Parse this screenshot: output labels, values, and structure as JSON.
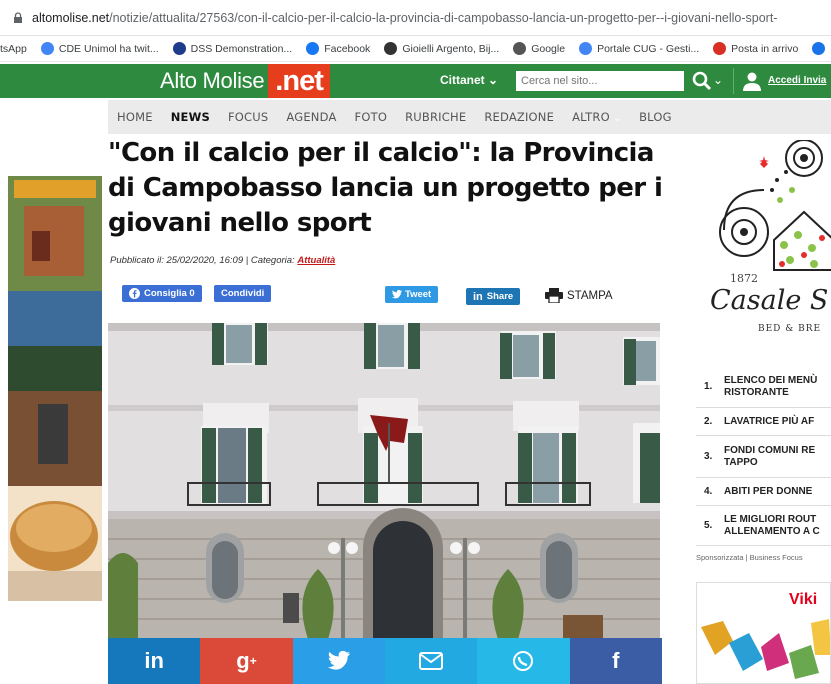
{
  "browser": {
    "url_host": "altomolise.net",
    "url_path": "/notizie/attualita/27563/con-il-calcio-per-il-calcio-la-provincia-di-campobasso-lancia-un-progetto-per--i-giovani-nello-sport-",
    "bookmarks": [
      {
        "label": "tsApp",
        "icon": "whatsapp-icon",
        "color": ""
      },
      {
        "label": "CDE Unimol ha twit...",
        "icon": "google-icon",
        "color": "#4285f4"
      },
      {
        "label": "DSS Demonstration...",
        "icon": "dss-icon",
        "color": "#1f3b8c"
      },
      {
        "label": "Facebook",
        "icon": "facebook-icon",
        "color": "#1877f2"
      },
      {
        "label": "Gioielli Argento, Bij...",
        "icon": "gioielli-icon",
        "color": "#333333"
      },
      {
        "label": "Google",
        "icon": "globe-icon",
        "color": "#555555"
      },
      {
        "label": "Portale CUG - Gesti...",
        "icon": "google-icon",
        "color": "#4285f4"
      },
      {
        "label": "Posta in arrivo",
        "icon": "gmail-icon",
        "color": "#d93025"
      },
      {
        "label": "Re",
        "icon": "bookmark-icon",
        "color": "#1a73e8"
      }
    ]
  },
  "header": {
    "logo_text": "Alto Molise",
    "logo_suffix": ".net",
    "cittanet_label": "Cittanet",
    "search_placeholder": "Cerca nel sito...",
    "login_label": "Accedi",
    "register_label": "Invia",
    "brand_green": "#2d8a3e",
    "brand_red": "#e63d1c"
  },
  "nav": {
    "items": [
      "HOME",
      "NEWS",
      "FOCUS",
      "AGENDA",
      "FOTO",
      "RUBRICHE",
      "REDAZIONE",
      "ALTRO",
      "BLOG"
    ],
    "active": "NEWS"
  },
  "article": {
    "title": "\"Con il calcio per il calcio\": la Provincia di Campobasso lancia un progetto per i giovani nello sport",
    "published_prefix": "Pubblicato il: 25/02/2020, 16:09 | Categoria:",
    "category": "Attualità"
  },
  "share": {
    "like_label": "Consiglia",
    "like_count": "0",
    "share_label": "Condividi",
    "tweet_label": "Tweet",
    "linkedin_label": "Share",
    "print_label": "STAMPA",
    "bar_colors": {
      "linkedin": "#1578bd",
      "googleplus": "#db4a39",
      "twitter": "#2a9fe7",
      "email": "#23a9e1",
      "whatsapp": "#26b8e6",
      "facebook": "#3b5da5"
    }
  },
  "right_ad": {
    "year": "1872",
    "title": "Casale S",
    "subtitle": "BED & BRE"
  },
  "sidebar": {
    "items": [
      {
        "num": "1.",
        "line1": "ELENCO DEI MENÙ",
        "line2": "RISTORANTE"
      },
      {
        "num": "2.",
        "line1": "LAVATRICE PIÙ AF",
        "line2": ""
      },
      {
        "num": "3.",
        "line1": "FONDI COMUNI RE",
        "line2": "TAPPO"
      },
      {
        "num": "4.",
        "line1": "ABITI PER DONNE",
        "line2": ""
      },
      {
        "num": "5.",
        "line1": "LE MIGLIORI ROUT",
        "line2": "ALLENAMENTO A C"
      }
    ],
    "sponsor": "Sponsorizzata | Business Focus",
    "banner_text": "Viki"
  }
}
